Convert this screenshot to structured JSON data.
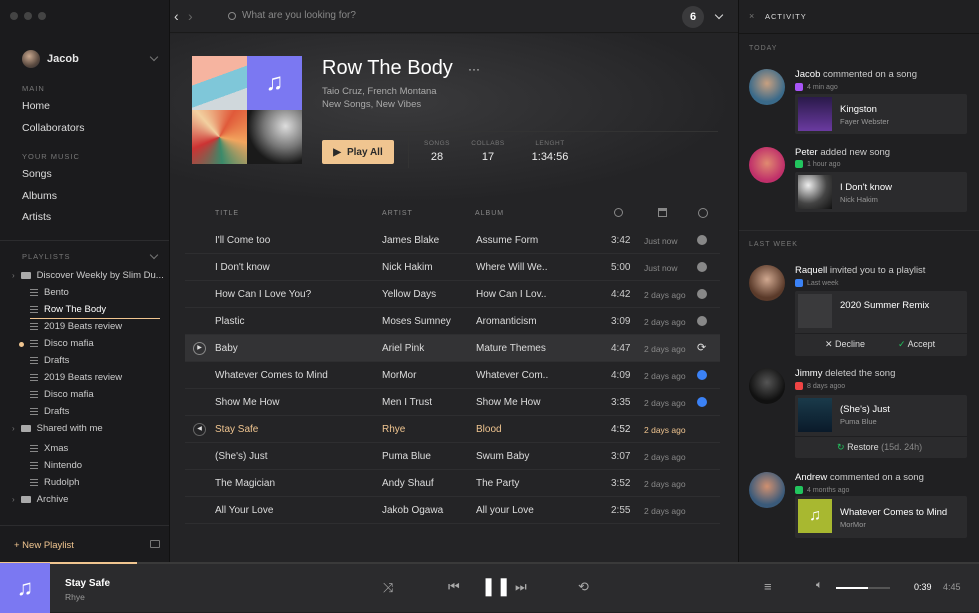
{
  "sidebar": {
    "user": "Jacob",
    "main_label": "MAIN",
    "main_items": [
      "Home",
      "Collaborators"
    ],
    "your_music_label": "YOUR MUSIC",
    "music_items": [
      "Songs",
      "Albums",
      "Artists"
    ],
    "playlists_label": "PLAYLISTS",
    "playlists": [
      {
        "label": "Discover Weekly by Slim Du...",
        "type": "folder"
      },
      {
        "label": "Bento",
        "type": "list"
      },
      {
        "label": "Row The Body",
        "type": "list",
        "active": true
      },
      {
        "label": "2019 Beats review",
        "type": "list"
      },
      {
        "label": "Disco mafia",
        "type": "list",
        "dot": true
      },
      {
        "label": "Drafts",
        "type": "list"
      },
      {
        "label": "2019 Beats review",
        "type": "list"
      },
      {
        "label": "Disco mafia",
        "type": "list"
      },
      {
        "label": "Drafts",
        "type": "list"
      },
      {
        "label": "Shared with me",
        "type": "folder"
      },
      {
        "label": "Xmas",
        "type": "list"
      },
      {
        "label": "Nintendo",
        "type": "list"
      },
      {
        "label": "Rudolph",
        "type": "list"
      },
      {
        "label": "Archive",
        "type": "folder"
      }
    ],
    "new_playlist": "+ New Playlist"
  },
  "top": {
    "search_placeholder": "What are you looking for?",
    "notif_count": "6"
  },
  "album": {
    "title": "Row The Body",
    "artists": "Taio Cruz, French Montana",
    "tags": "New Songs, New Vibes",
    "play_label": "Play All",
    "stats": [
      {
        "label": "SONGS",
        "value": "28"
      },
      {
        "label": "COLLABS",
        "value": "17"
      },
      {
        "label": "LENGHT",
        "value": "1:34:56"
      }
    ]
  },
  "table": {
    "headers": {
      "title": "TITLE",
      "artist": "ARTIST",
      "album": "ALBUM"
    },
    "rows": [
      {
        "title": "I'll Come too",
        "artist": "James Blake",
        "album": "Assume Form",
        "time": "3:42",
        "date": "Just now",
        "status": "grey"
      },
      {
        "title": "I Don't know",
        "artist": "Nick Hakim",
        "album": "Where Will We..",
        "time": "5:00",
        "date": "Just now",
        "status": "grey"
      },
      {
        "title": "How Can I Love You?",
        "artist": "Yellow Days",
        "album": "How Can I Lov..",
        "time": "4:42",
        "date": "2 days ago",
        "status": "grey"
      },
      {
        "title": "Plastic",
        "artist": "Moses Sumney",
        "album": "Aromanticism",
        "time": "3:09",
        "date": "2 days ago",
        "status": "grey"
      },
      {
        "title": "Baby",
        "artist": "Ariel Pink",
        "album": "Mature Themes",
        "time": "4:47",
        "date": "2 days ago",
        "status": "sync",
        "selected": true
      },
      {
        "title": "Whatever Comes to Mind",
        "artist": "MorMor",
        "album": "Whatever Com..",
        "time": "4:09",
        "date": "2 days ago",
        "status": "blue"
      },
      {
        "title": "Show Me How",
        "artist": "Men I Trust",
        "album": "Show Me How",
        "time": "3:35",
        "date": "2 days ago",
        "status": "blue"
      },
      {
        "title": "Stay Safe",
        "artist": "Rhye",
        "album": "Blood",
        "time": "4:52",
        "date": "2 days ago",
        "status": "none",
        "playing": true
      },
      {
        "title": "(She's) Just",
        "artist": "Puma Blue",
        "album": "Swum Baby",
        "time": "3:07",
        "date": "2 days ago",
        "status": "none"
      },
      {
        "title": "The Magician",
        "artist": "Andy Shauf",
        "album": "The Party",
        "time": "3:52",
        "date": "2 days ago",
        "status": "none"
      },
      {
        "title": "All Your Love",
        "artist": "Jakob Ogawa",
        "album": "All your Love",
        "time": "2:55",
        "date": "2 days ago",
        "status": "none"
      }
    ]
  },
  "activity": {
    "title": "ACTIVITY",
    "today": "TODAY",
    "last_week": "LAST WEEK",
    "items": [
      {
        "user": "Jacob",
        "action": "commented on a song",
        "meta": "4 min ago",
        "meta_color": "#a855f7",
        "card_title": "Kingston",
        "card_sub": "Fayer Webster"
      },
      {
        "user": "Peter",
        "action": "added new song",
        "meta": "1 hour ago",
        "meta_color": "#22c55e",
        "card_title": "I Don't know",
        "card_sub": "Nick Hakim"
      },
      {
        "user": "Raquell",
        "action": "invited you to a playlist",
        "meta": "Last week",
        "meta_color": "#3b82f6",
        "card_title": "2020 Summer Remix",
        "decline": "Decline",
        "accept": "Accept"
      },
      {
        "user": "Jimmy",
        "action": "deleted the song",
        "meta": "8 days agoo",
        "meta_color": "#ef4444",
        "card_title": "(She's) Just",
        "card_sub": "Puma Blue",
        "restore": "Restore",
        "restore_note": "(15d. 24h)"
      },
      {
        "user": "Andrew",
        "action": "commented on a song",
        "meta": "4 months ago",
        "meta_color": "#22c55e",
        "card_title": "Whatever Comes to Mind",
        "card_sub": "MorMor"
      }
    ]
  },
  "player": {
    "title": "Stay Safe",
    "artist": "Rhye",
    "elapsed": "0:39",
    "total": "4:45",
    "progress": 0.14,
    "volume": 0.6
  }
}
